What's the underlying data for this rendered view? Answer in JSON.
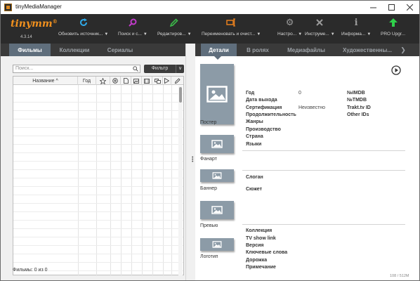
{
  "window": {
    "title": "tinyMediaManager"
  },
  "logo": {
    "text": "tinymm",
    "sup": "®",
    "version": "4.3.14"
  },
  "toolbar": [
    {
      "id": "update",
      "label": "Обновить источник...",
      "icon": "refresh-icon",
      "color": "#2fa9e8"
    },
    {
      "id": "search",
      "label": "Поиск и с...",
      "icon": "search-icon",
      "color": "#c03bc8"
    },
    {
      "id": "edit",
      "label": "Редактиров...",
      "icon": "pencil-icon",
      "color": "#3cb84a"
    },
    {
      "id": "rename",
      "label": "Переименовать и очист...",
      "icon": "rename-icon",
      "color": "#e8801e"
    },
    {
      "id": "settings",
      "label": "Настро...",
      "icon": "gear-icon",
      "color": "#9a9a9a"
    },
    {
      "id": "tools",
      "label": "Инструме...",
      "icon": "tools-icon",
      "color": "#9a9a9a"
    },
    {
      "id": "info",
      "label": "Информа...",
      "icon": "info-icon",
      "color": "#9a9a9a"
    },
    {
      "id": "pro",
      "label": "PRO Upgr...",
      "icon": "arrow-up-icon",
      "color": "#2fd14a"
    }
  ],
  "left_tabs": [
    "Фильмы",
    "Коллекции",
    "Сериалы"
  ],
  "search": {
    "placeholder": "Поиск...",
    "filter_label": "Фильтр"
  },
  "table": {
    "columns": [
      "Название ^",
      "Год"
    ],
    "icon_columns": [
      "star-icon",
      "add-icon",
      "file-icon",
      "image-icon",
      "film-icon",
      "subtitle-icon",
      "play-icon",
      "pen-icon"
    ]
  },
  "status": {
    "text": "Фильмы: 0 из 0"
  },
  "right_tabs": [
    "Детали",
    "В ролях",
    "Медиафайлы",
    "Художественны..."
  ],
  "art": {
    "poster": "Постер",
    "fanart": "Фанарт",
    "banner": "Баннер",
    "preview": "Превью",
    "logo": "Логотип"
  },
  "details": {
    "year_label": "Год",
    "year_value": "0",
    "release_label": "Дата выхода",
    "cert_label": "Сертификация",
    "cert_value": "Неизвестно",
    "runtime_label": "Продолжительность",
    "genres_label": "Жанры",
    "production_label": "Производство",
    "country_label": "Страна",
    "languages_label": "Языки",
    "imdb_label": "№IMDB",
    "tmdb_label": "№TMDB",
    "trakt_label": "Trakt.tv ID",
    "other_label": "Other IDs",
    "tagline_label": "Слоган",
    "plot_label": "Сюжет",
    "collection_label": "Коллекция",
    "tvshow_label": "TV show link",
    "version_label": "Версия",
    "keywords_label": "Ключевые слова",
    "track_label": "Дорожка",
    "note_label": "Примечание"
  },
  "corner_text": "108 / 512M"
}
